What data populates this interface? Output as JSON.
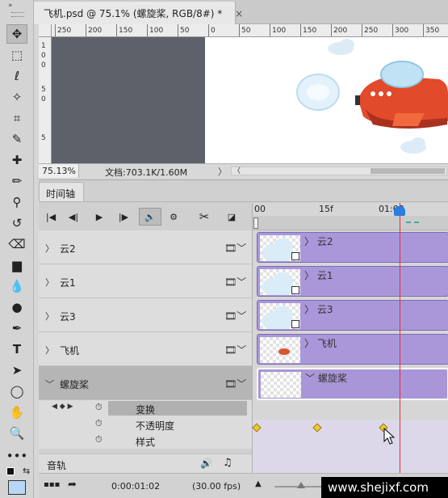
{
  "document_tab": {
    "title": "飞机.psd @ 75.1% (螺旋桨, RGB/8#) *",
    "close": "×"
  },
  "ruler_top_ticks": [
    "250",
    "200",
    "150",
    "100",
    "50",
    "0",
    "50",
    "100",
    "150",
    "200",
    "250",
    "300",
    "350"
  ],
  "ruler_left_ticks": [
    "1",
    "0",
    "0",
    "5",
    "0",
    "5"
  ],
  "status_bar": {
    "zoom": "75.13%",
    "doc_info": "文档:703.1K/1.60M",
    "arrow": "〉",
    "scroll_left": "〈"
  },
  "timeline": {
    "tab_label": "时间轴",
    "ruler_labels": {
      "start": "00",
      "mid": "15f",
      "sec": "01:00"
    },
    "layers": [
      {
        "name": "云2",
        "chevron": "〉",
        "clip_label": "云2",
        "clip_chevron": "〉"
      },
      {
        "name": "云1",
        "chevron": "〉",
        "clip_label": "云1",
        "clip_chevron": "〉"
      },
      {
        "name": "云3",
        "chevron": "〉",
        "clip_label": "云3",
        "clip_chevron": "〉"
      },
      {
        "name": "飞机",
        "chevron": "〉",
        "clip_label": "飞机",
        "clip_chevron": "〉"
      },
      {
        "name": "螺旋桨",
        "chevron": "﹀",
        "clip_label": "螺旋桨",
        "clip_chevron": "﹀"
      }
    ],
    "properties": [
      {
        "name": "变换"
      },
      {
        "name": "不透明度"
      },
      {
        "name": "样式"
      }
    ],
    "audio_track": {
      "name": "音轨"
    },
    "current_time": "0:00:01:02",
    "frame_rate": "(30.00 fps)",
    "film_icon": "🎞﹀"
  },
  "watermark": "www.shejixf.com",
  "colors": {
    "clip": "#aa97d9",
    "playhead": "#e0303a",
    "keyframe": "#e8c93a",
    "pasteboard": "#5d6169"
  }
}
